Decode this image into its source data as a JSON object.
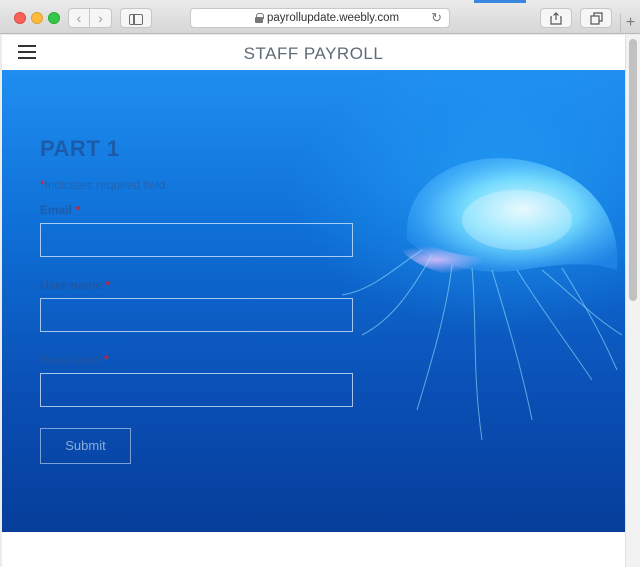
{
  "browser": {
    "url": "payrollupdate.weebly.com",
    "back_glyph": "‹",
    "forward_glyph": "›",
    "reload_glyph": "↻",
    "new_tab_glyph": "+"
  },
  "site": {
    "title": "STAFF PAYROLL"
  },
  "form": {
    "heading": "PART 1",
    "required_star": "*",
    "required_note": "Indicates required field",
    "fields": [
      {
        "label": "Email",
        "value": ""
      },
      {
        "label": "User-name",
        "value": ""
      },
      {
        "label": "Pass-word",
        "value": ""
      }
    ],
    "submit_label": "Submit"
  },
  "colors": {
    "accent": "#3b87e0",
    "required": "#d0203a",
    "hero_top": "#1f8ef0",
    "hero_bottom": "#063e9a"
  },
  "icons": [
    "sidebar-icon",
    "lock-icon",
    "reload-icon",
    "share-icon",
    "tabs-icon",
    "hamburger-menu-icon",
    "jellyfish-image"
  ]
}
